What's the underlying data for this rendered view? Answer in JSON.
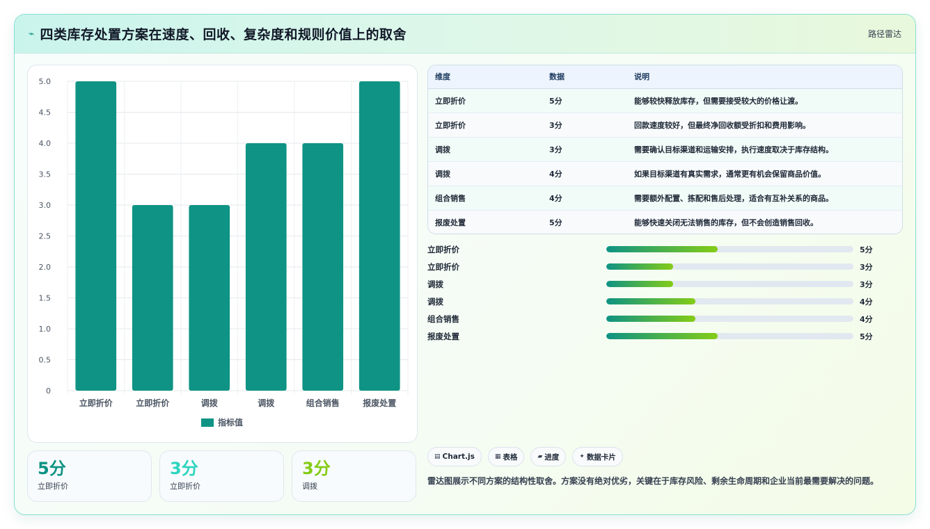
{
  "header": {
    "icon": "bolt-icon",
    "title": "四类库存处置方案在速度、回收、复杂度和规则价值上的取舍",
    "tag": "路径雷达"
  },
  "chart_data": {
    "type": "bar",
    "categories": [
      "立即折价",
      "立即折价",
      "调拨",
      "调拨",
      "组合销售",
      "报废处置"
    ],
    "series": [
      {
        "name": "指标值",
        "values": [
          5,
          3,
          3,
          4,
          4,
          5
        ]
      }
    ],
    "ylim": [
      0,
      5
    ],
    "yticks": [
      "5.0",
      "4.5",
      "4.0",
      "3.5",
      "3.0",
      "2.5",
      "2.0",
      "1.5",
      "1.0",
      "0.5",
      "0"
    ],
    "grid": true,
    "legend": "bottom",
    "colors": {
      "bar": "#0e9384"
    }
  },
  "stats": [
    {
      "value": "5分",
      "label": "立即折价",
      "color": "#0e9384"
    },
    {
      "value": "3分",
      "label": "立即折价",
      "color": "#2dd4bf"
    },
    {
      "value": "3分",
      "label": "调拨",
      "color": "#84cc16"
    }
  ],
  "table": {
    "headers": [
      "维度",
      "数据",
      "说明"
    ],
    "rows": [
      [
        "立即折价",
        "5分",
        "能够较快释放库存，但需要接受较大的价格让渡。"
      ],
      [
        "立即折价",
        "3分",
        "回款速度较好，但最终净回收额受折扣和费用影响。"
      ],
      [
        "调拨",
        "3分",
        "需要确认目标渠道和运输安排，执行速度取决于库存结构。"
      ],
      [
        "调拨",
        "4分",
        "如果目标渠道有真实需求，通常更有机会保留商品价值。"
      ],
      [
        "组合销售",
        "4分",
        "需要额外配置、拣配和售后处理，适合有互补关系的商品。"
      ],
      [
        "报废处置",
        "5分",
        "能够快速关闭无法销售的库存，但不会创造销售回收。"
      ]
    ]
  },
  "progress": [
    {
      "label": "立即折价",
      "value": "5分",
      "fraction": 0.45
    },
    {
      "label": "立即折价",
      "value": "3分",
      "fraction": 0.27
    },
    {
      "label": "调拨",
      "value": "3分",
      "fraction": 0.27
    },
    {
      "label": "调拨",
      "value": "4分",
      "fraction": 0.36
    },
    {
      "label": "组合销售",
      "value": "4分",
      "fraction": 0.36
    },
    {
      "label": "报废处置",
      "value": "5分",
      "fraction": 0.45
    }
  ],
  "chips": [
    {
      "icon": "chart-icon",
      "label": "Chart.js"
    },
    {
      "icon": "table-icon",
      "label": "表格"
    },
    {
      "icon": "progress-icon",
      "label": "进度"
    },
    {
      "icon": "sparkle-icon",
      "label": "数据卡片"
    }
  ],
  "note": "雷达图展示不同方案的结构性取舍。方案没有绝对优劣，关键在于库存风险、剩余生命周期和企业当前最需要解决的问题。"
}
